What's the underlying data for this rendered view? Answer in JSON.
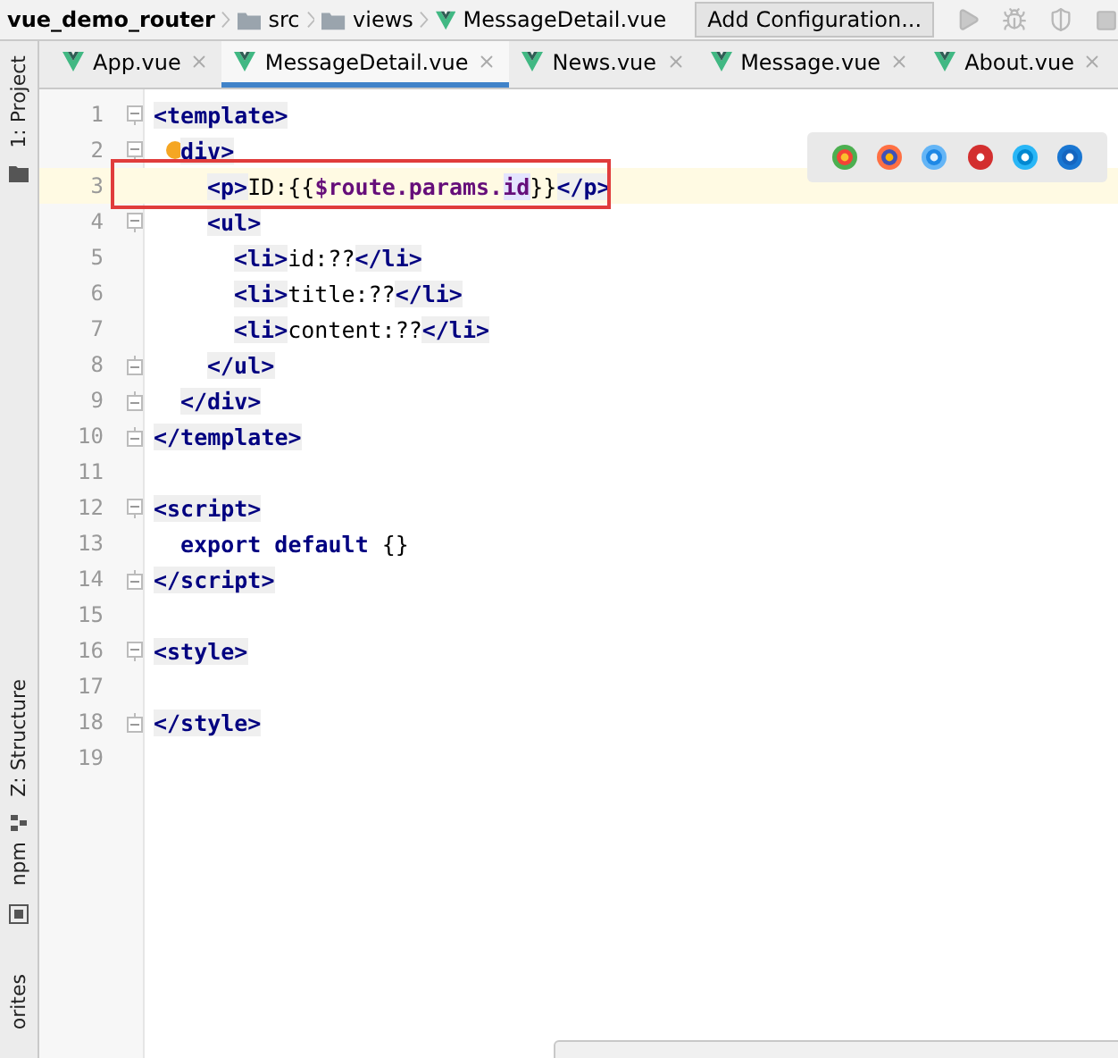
{
  "breadcrumb": [
    {
      "label": "vue_demo_router",
      "kind": "project"
    },
    {
      "label": "src",
      "kind": "folder"
    },
    {
      "label": "views",
      "kind": "folder"
    },
    {
      "label": "MessageDetail.vue",
      "kind": "vue"
    }
  ],
  "run_config": {
    "label": "Add Configuration..."
  },
  "tool_strip": [
    {
      "label": "1: Project",
      "kind": "project"
    },
    {
      "label": "Z: Structure",
      "kind": "structure"
    },
    {
      "label": "npm",
      "kind": "npm"
    },
    {
      "label": "orites",
      "kind": "favorites"
    }
  ],
  "tabs": [
    {
      "label": "App.vue",
      "selected": false
    },
    {
      "label": "MessageDetail.vue",
      "selected": true
    },
    {
      "label": "News.vue",
      "selected": false
    },
    {
      "label": "Message.vue",
      "selected": false
    },
    {
      "label": "About.vue",
      "selected": false
    }
  ],
  "lines": [
    {
      "number": "1",
      "fold_start": true,
      "fold_end": false,
      "current": false,
      "boxed": false,
      "bulb": false,
      "tokens": [
        {
          "t": "<template>",
          "kind": "tag"
        }
      ],
      "children": [
        {
          "number": "2",
          "fold_start": true,
          "fold_end": false,
          "current": false,
          "boxed": false,
          "bulb": true,
          "tokens": [
            {
              "t": "div>",
              "kind": "tag"
            }
          ],
          "children": [
            {
              "number": "3",
              "fold_start": false,
              "fold_end": false,
              "current": true,
              "boxed": true,
              "bulb": false,
              "tokens": [
                {
                  "t": "<p>",
                  "kind": "tag"
                },
                {
                  "t": "ID:{{",
                  "kind": "text"
                },
                {
                  "t": "$route.params.",
                  "kind": "var"
                },
                {
                  "t": "id",
                  "kind": "match"
                },
                {
                  "t": "}}",
                  "kind": "text"
                },
                {
                  "t": "</p>",
                  "kind": "tag"
                }
              ]
            },
            {
              "number": "4",
              "fold_start": true,
              "fold_end": false,
              "current": false,
              "boxed": false,
              "bulb": false,
              "tokens": [
                {
                  "t": "<ul>",
                  "kind": "tag"
                }
              ],
              "children": [
                {
                  "number": "5",
                  "fold_start": false,
                  "fold_end": false,
                  "current": false,
                  "boxed": false,
                  "bulb": false,
                  "tokens": [
                    {
                      "t": "<li>",
                      "kind": "tag"
                    },
                    {
                      "t": "id:??",
                      "kind": "text"
                    },
                    {
                      "t": "</li>",
                      "kind": "tag"
                    }
                  ]
                },
                {
                  "number": "6",
                  "fold_start": false,
                  "fold_end": false,
                  "current": false,
                  "boxed": false,
                  "bulb": false,
                  "tokens": [
                    {
                      "t": "<li>",
                      "kind": "tag"
                    },
                    {
                      "t": "title:??",
                      "kind": "text"
                    },
                    {
                      "t": "</li>",
                      "kind": "tag"
                    }
                  ]
                },
                {
                  "number": "7",
                  "fold_start": false,
                  "fold_end": false,
                  "current": false,
                  "boxed": false,
                  "bulb": false,
                  "tokens": [
                    {
                      "t": "<li>",
                      "kind": "tag"
                    },
                    {
                      "t": "content:??",
                      "kind": "text"
                    },
                    {
                      "t": "</li>",
                      "kind": "tag"
                    }
                  ]
                }
              ]
            },
            {
              "number": "8",
              "fold_start": false,
              "fold_end": true,
              "current": false,
              "boxed": false,
              "bulb": false,
              "tokens": [
                {
                  "t": "</ul>",
                  "kind": "tag"
                }
              ]
            }
          ]
        },
        {
          "number": "9",
          "fold_start": false,
          "fold_end": true,
          "current": false,
          "boxed": false,
          "bulb": false,
          "tokens": [
            {
              "t": "</div>",
              "kind": "tag"
            }
          ]
        }
      ]
    },
    {
      "number": "10",
      "fold_start": false,
      "fold_end": true,
      "current": false,
      "boxed": false,
      "bulb": false,
      "tokens": [
        {
          "t": "</template>",
          "kind": "tag"
        }
      ]
    },
    {
      "number": "11",
      "fold_start": false,
      "fold_end": false,
      "current": false,
      "boxed": false,
      "bulb": false
    },
    {
      "number": "12",
      "fold_start": true,
      "fold_end": false,
      "current": false,
      "boxed": false,
      "bulb": false,
      "tokens": [
        {
          "t": "<script>",
          "kind": "tag"
        }
      ],
      "children": [
        {
          "number": "13",
          "fold_start": false,
          "fold_end": false,
          "current": false,
          "boxed": false,
          "bulb": false,
          "tokens": [
            {
              "t": "export default",
              "kind": "keyword"
            },
            {
              "t": " {}",
              "kind": "text"
            }
          ]
        }
      ]
    },
    {
      "number": "14",
      "fold_start": false,
      "fold_end": true,
      "current": false,
      "boxed": false,
      "bulb": false,
      "tokens": [
        {
          "t": "</script>",
          "kind": "tag"
        }
      ]
    },
    {
      "number": "15",
      "fold_start": false,
      "fold_end": false,
      "current": false,
      "boxed": false,
      "bulb": false
    },
    {
      "number": "16",
      "fold_start": true,
      "fold_end": false,
      "current": false,
      "boxed": false,
      "bulb": false,
      "tokens": [
        {
          "t": "<style>",
          "kind": "tag"
        }
      ]
    },
    {
      "number": "17",
      "fold_start": false,
      "fold_end": false,
      "current": false,
      "boxed": false,
      "bulb": false
    },
    {
      "number": "18",
      "fold_start": false,
      "fold_end": true,
      "current": false,
      "boxed": false,
      "bulb": false,
      "tokens": [
        {
          "t": "</style>",
          "kind": "tag"
        }
      ]
    },
    {
      "number": "19",
      "fold_start": false,
      "fold_end": false,
      "current": false,
      "boxed": false,
      "bulb": false
    }
  ]
}
